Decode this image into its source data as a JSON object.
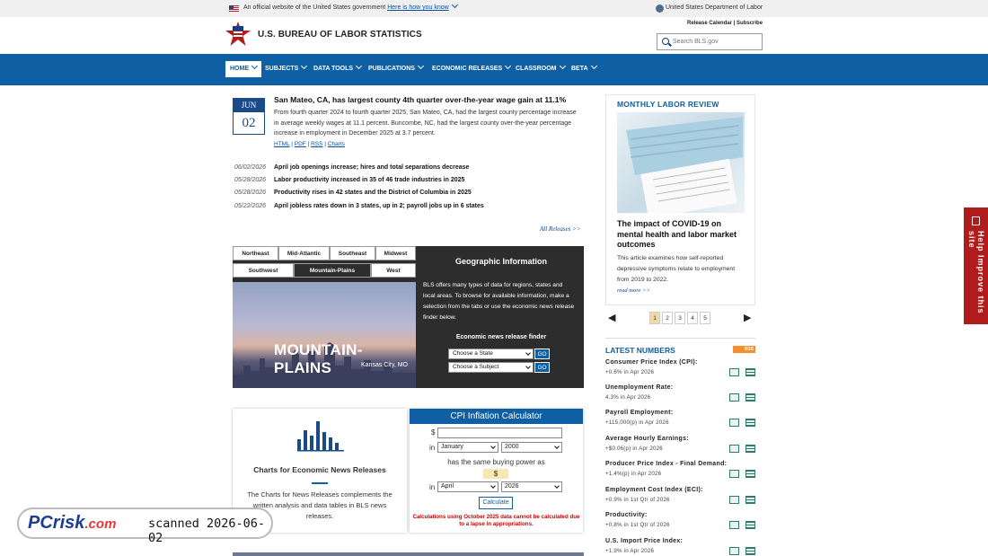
{
  "gov_banner": {
    "text": "An official website of the United States government",
    "link": "Here is how you know",
    "dept": "United States Department of Labor"
  },
  "site": {
    "title": "U.S. BUREAU OF LABOR STATISTICS",
    "util_links": "Release Calendar | Subscribe",
    "search_placeholder": "Search BLS.gov"
  },
  "nav": {
    "items": [
      "HOME",
      "SUBJECTS",
      "DATA TOOLS",
      "PUBLICATIONS",
      "ECONOMIC RELEASES",
      "CLASSROOM",
      "BETA"
    ]
  },
  "feature": {
    "month": "JUN",
    "day": "02",
    "headline": "San Mateo, CA, has largest county 4th quarter over-the-year wage gain at 11.1%",
    "summary": "From fourth quarter 2024 to fourth quarter 2025, San Mateo, CA, had the largest county percentage increase in average weekly wages at 11.1 percent. Buncombe, NC, had the largest county over-the-year percentage increase in employment in December 2025 at 3.7 percent.",
    "links": [
      "HTML",
      "PDF",
      "RSS",
      "Charts"
    ]
  },
  "releases": [
    {
      "date": "06/02/2026",
      "title": "April job openings increase; hires and total separations decrease"
    },
    {
      "date": "05/28/2026",
      "title": "Labor productivity increased in 35 of 46 trade industries in 2025"
    },
    {
      "date": "05/28/2026",
      "title": "Productivity rises in 42 states and the District of Columbia in 2025"
    },
    {
      "date": "05/22/2026",
      "title": "April jobless rates down in 3 states, up in 2; payroll jobs up in 6 states"
    }
  ],
  "all_releases": "All Releases >>",
  "geo": {
    "tabs_row1": [
      "Northeast",
      "Mid-Atlantic",
      "Southeast",
      "Midwest"
    ],
    "tabs_row2": [
      "Southwest",
      "Mountain-Plains",
      "West"
    ],
    "region": "MOUNTAIN-PLAINS",
    "city": "Kansas City, MO",
    "title": "Geographic Information",
    "text": "BLS offers many types of data for regions, states and local areas. To browse for available information, make a selection from the tabs or use the economic news release finder below.",
    "finder": "Economic news release finder",
    "select_state": "Choose a State",
    "select_subject": "Choose a Subject",
    "go": "GO"
  },
  "charts_card": {
    "title": "Charts for Economic News Releases",
    "text": "The Charts for News Releases complements the written analysis and data tables in BLS news releases."
  },
  "cpi_calc": {
    "title": "CPI Inflation Calculator",
    "dollar": "$",
    "in": "in",
    "month1": "January",
    "year1": "2000",
    "same": "has the same buying power as",
    "result": "$",
    "month2": "April",
    "year2": "2026",
    "button": "Calculate",
    "warning": "Calculations using October 2025 data cannot be calculated due to a lapse in appropriations."
  },
  "mlr": {
    "title": "MONTHLY LABOR REVIEW",
    "headline": "The impact of COVID-19 on mental health and labor market outcomes",
    "text": "This article examines how self-reported depressive symptoms relate to employment from 2019 to 2022.",
    "more": "read more >>",
    "pages": [
      "1",
      "2",
      "3",
      "4",
      "5"
    ],
    "current_page": "1"
  },
  "latest": {
    "title": "LATEST NUMBERS",
    "rss": "RSS",
    "items": [
      {
        "name": "Consumer Price Index (CPI):",
        "value": "+0.6% in Apr 2026"
      },
      {
        "name": "Unemployment Rate:",
        "value": "4.3% in Apr 2026"
      },
      {
        "name": "Payroll Employment:",
        "value": "+115,000(p) in Apr 2026"
      },
      {
        "name": "Average Hourly Earnings:",
        "value": "+$0.06(p) in Apr 2026"
      },
      {
        "name": "Producer Price Index - Final Demand:",
        "value": "+1.4%(p) in Apr 2026"
      },
      {
        "name": "Employment Cost Index (ECI):",
        "value": "+0.9% in 1st Qtr of 2026"
      },
      {
        "name": "Productivity:",
        "value": "+0.8% in 1st Qtr of 2026"
      },
      {
        "name": "U.S. Import Price Index:",
        "value": "+1.9% in Apr 2026"
      }
    ]
  },
  "help_tab": "Help Improve this site",
  "watermark": {
    "logo": "PC",
    "logo2": "risk",
    "logo3": ".com",
    "scan": "scanned 2026-06-02"
  },
  "colors": {
    "nav": "#0e5fa4",
    "accent_red": "#b01c1c",
    "date_blue": "#1b4a8a"
  }
}
